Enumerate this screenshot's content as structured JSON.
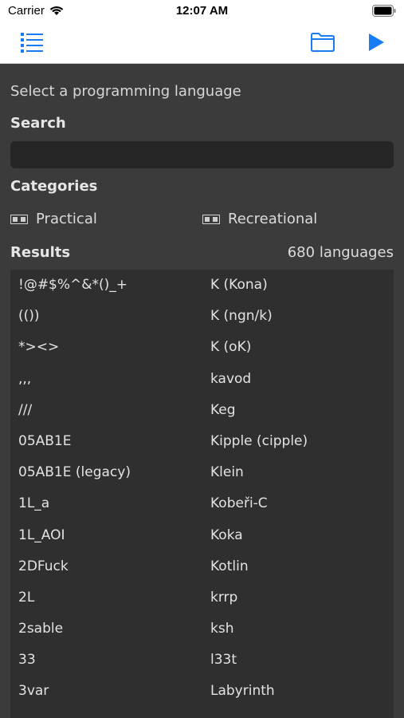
{
  "status_bar": {
    "carrier": "Carrier",
    "time": "12:07 AM"
  },
  "navbar": {
    "icons": [
      "list-icon",
      "folder-icon",
      "play-icon"
    ],
    "accent": "#1a7cf5"
  },
  "main": {
    "prompt": "Select a programming language",
    "search": {
      "label": "Search",
      "value": "",
      "placeholder": ""
    },
    "categories": {
      "label": "Categories",
      "items": [
        "Practical",
        "Recreational"
      ]
    },
    "results": {
      "label": "Results",
      "count": "680 languages",
      "left": [
        "!@#$%^&*()_+",
        "(())",
        "*><>",
        ",,,",
        "///",
        "05AB1E",
        "05AB1E (legacy)",
        "1L_a",
        "1L_AOI",
        "2DFuck",
        "2L",
        "2sable",
        "33",
        "3var"
      ],
      "right": [
        "K (Kona)",
        "K (ngn/k)",
        "K (oK)",
        "kavod",
        "Keg",
        "Kipple (cipple)",
        "Klein",
        "Kobeři-C",
        "Koka",
        "Kotlin",
        "krrp",
        "ksh",
        "l33t",
        "Labyrinth"
      ]
    }
  },
  "colors": {
    "background": "#3b3b3b",
    "panel": "#2f2f2f",
    "input": "#262626",
    "text": "#e6e6e6"
  }
}
